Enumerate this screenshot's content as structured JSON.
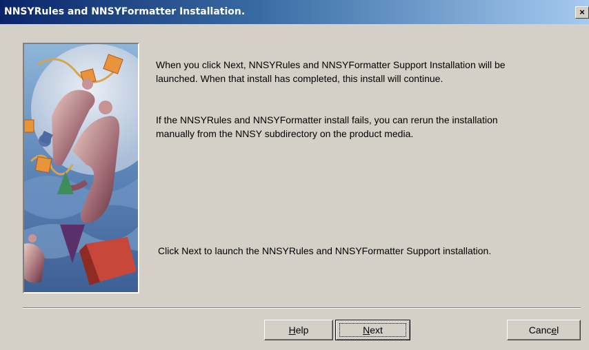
{
  "window": {
    "title": "NNSYRules and NNSYFormatter Installation.",
    "close_glyph": "×"
  },
  "content": {
    "message_1_line_1": "When you click Next, NNSYRules and NNSYFormatter Support Installation will be",
    "message_1_line_2": "launched. When that install has completed, this install will continue.",
    "message_2_line_1": "If the NNSYRules and NNSYFormatter install fails, you can rerun the installation",
    "message_2_line_2": "manually from the NNSY subdirectory on the product media.",
    "message_3": "Click Next to launch the NNSYRules and NNSYFormatter Support installation."
  },
  "buttons": {
    "help": {
      "label_prefix": "",
      "mnemonic": "H",
      "label_suffix": "elp"
    },
    "next": {
      "label_prefix": "",
      "mnemonic": "N",
      "label_suffix": "ext"
    },
    "cancel": {
      "label_prefix": "Canc",
      "mnemonic": "e",
      "label_suffix": "l"
    }
  },
  "colors": {
    "dialog_bg": "#d4d0c8",
    "title_start": "#0a246a",
    "title_end": "#a6caf0"
  },
  "icons": {
    "close": "close-icon",
    "art": "installer-artwork"
  }
}
